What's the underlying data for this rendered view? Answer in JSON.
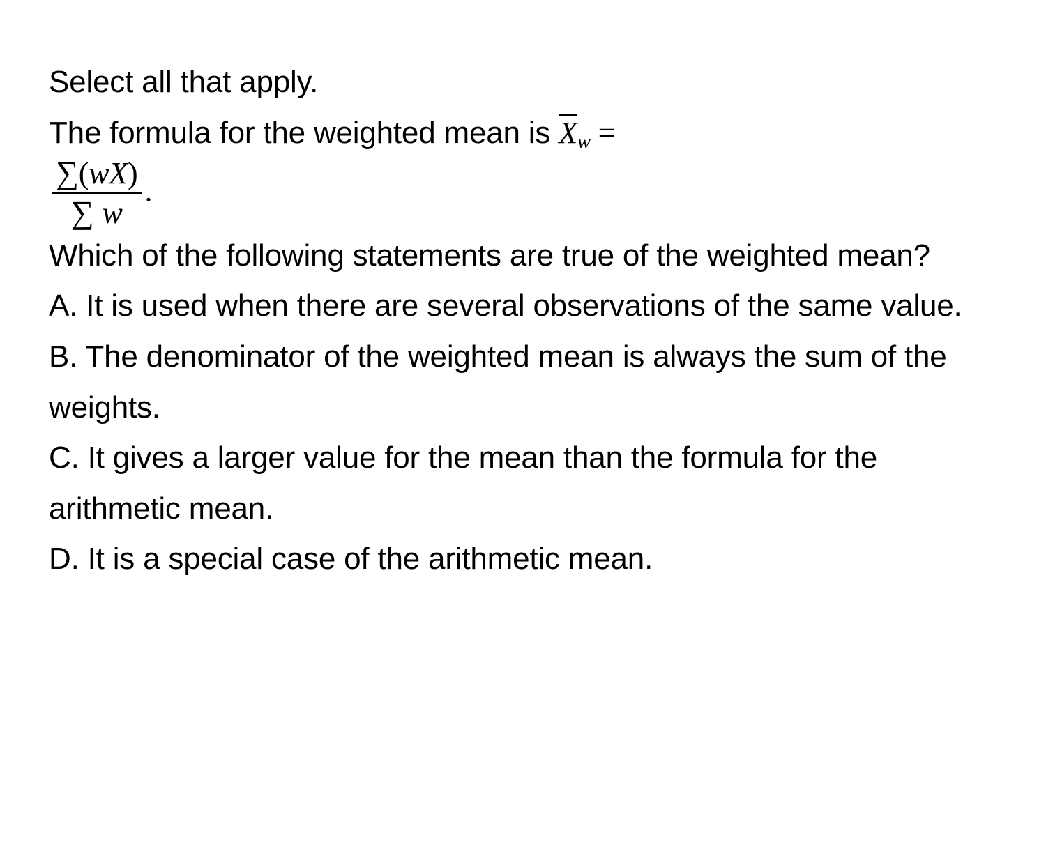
{
  "instruction": "Select all that apply.",
  "intro_prefix": "The formula for the weighted mean is ",
  "formula": {
    "lhs_var": "X",
    "lhs_sub": "w",
    "eq": " = ",
    "num_sigma": "∑",
    "num_open": "(",
    "num_w": "w",
    "num_X": "X",
    "num_close": ")",
    "den_sigma": "∑",
    "den_w": "w",
    "period": "."
  },
  "question": "Which of the following statements are true of the weighted mean?",
  "options": {
    "A": "A. It is used when there are several observations of the same value.",
    "B": "B. The denominator of the weighted mean is always the sum of the weights.",
    "C": "C. It gives a larger value for the mean than the formula for the arithmetic mean.",
    "D": "D. It is a special case of the arithmetic mean."
  }
}
